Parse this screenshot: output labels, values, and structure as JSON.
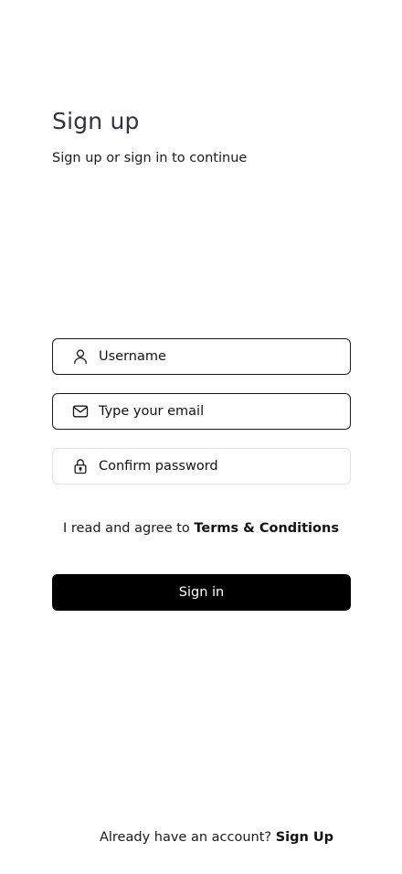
{
  "header": {
    "title": "Sign up",
    "subtitle": "Sign up or sign in to continue"
  },
  "form": {
    "username": {
      "placeholder": "Username",
      "value": "",
      "icon": "user-icon"
    },
    "email": {
      "placeholder": "Type your email",
      "value": "",
      "icon": "mail-icon"
    },
    "confirm_password": {
      "placeholder": "Confirm password",
      "value": "",
      "icon": "lock-icon"
    },
    "agree_text": "I read and agree to",
    "terms_link": "Terms & Conditions",
    "submit_label": "Sign in"
  },
  "footer": {
    "prompt": "Already have an account?",
    "link": "Sign Up"
  },
  "colors": {
    "primary_button": "#000000",
    "title": "#2f3340",
    "active_border": "#1a1a1a",
    "inactive_border": "#e3e3e3"
  }
}
